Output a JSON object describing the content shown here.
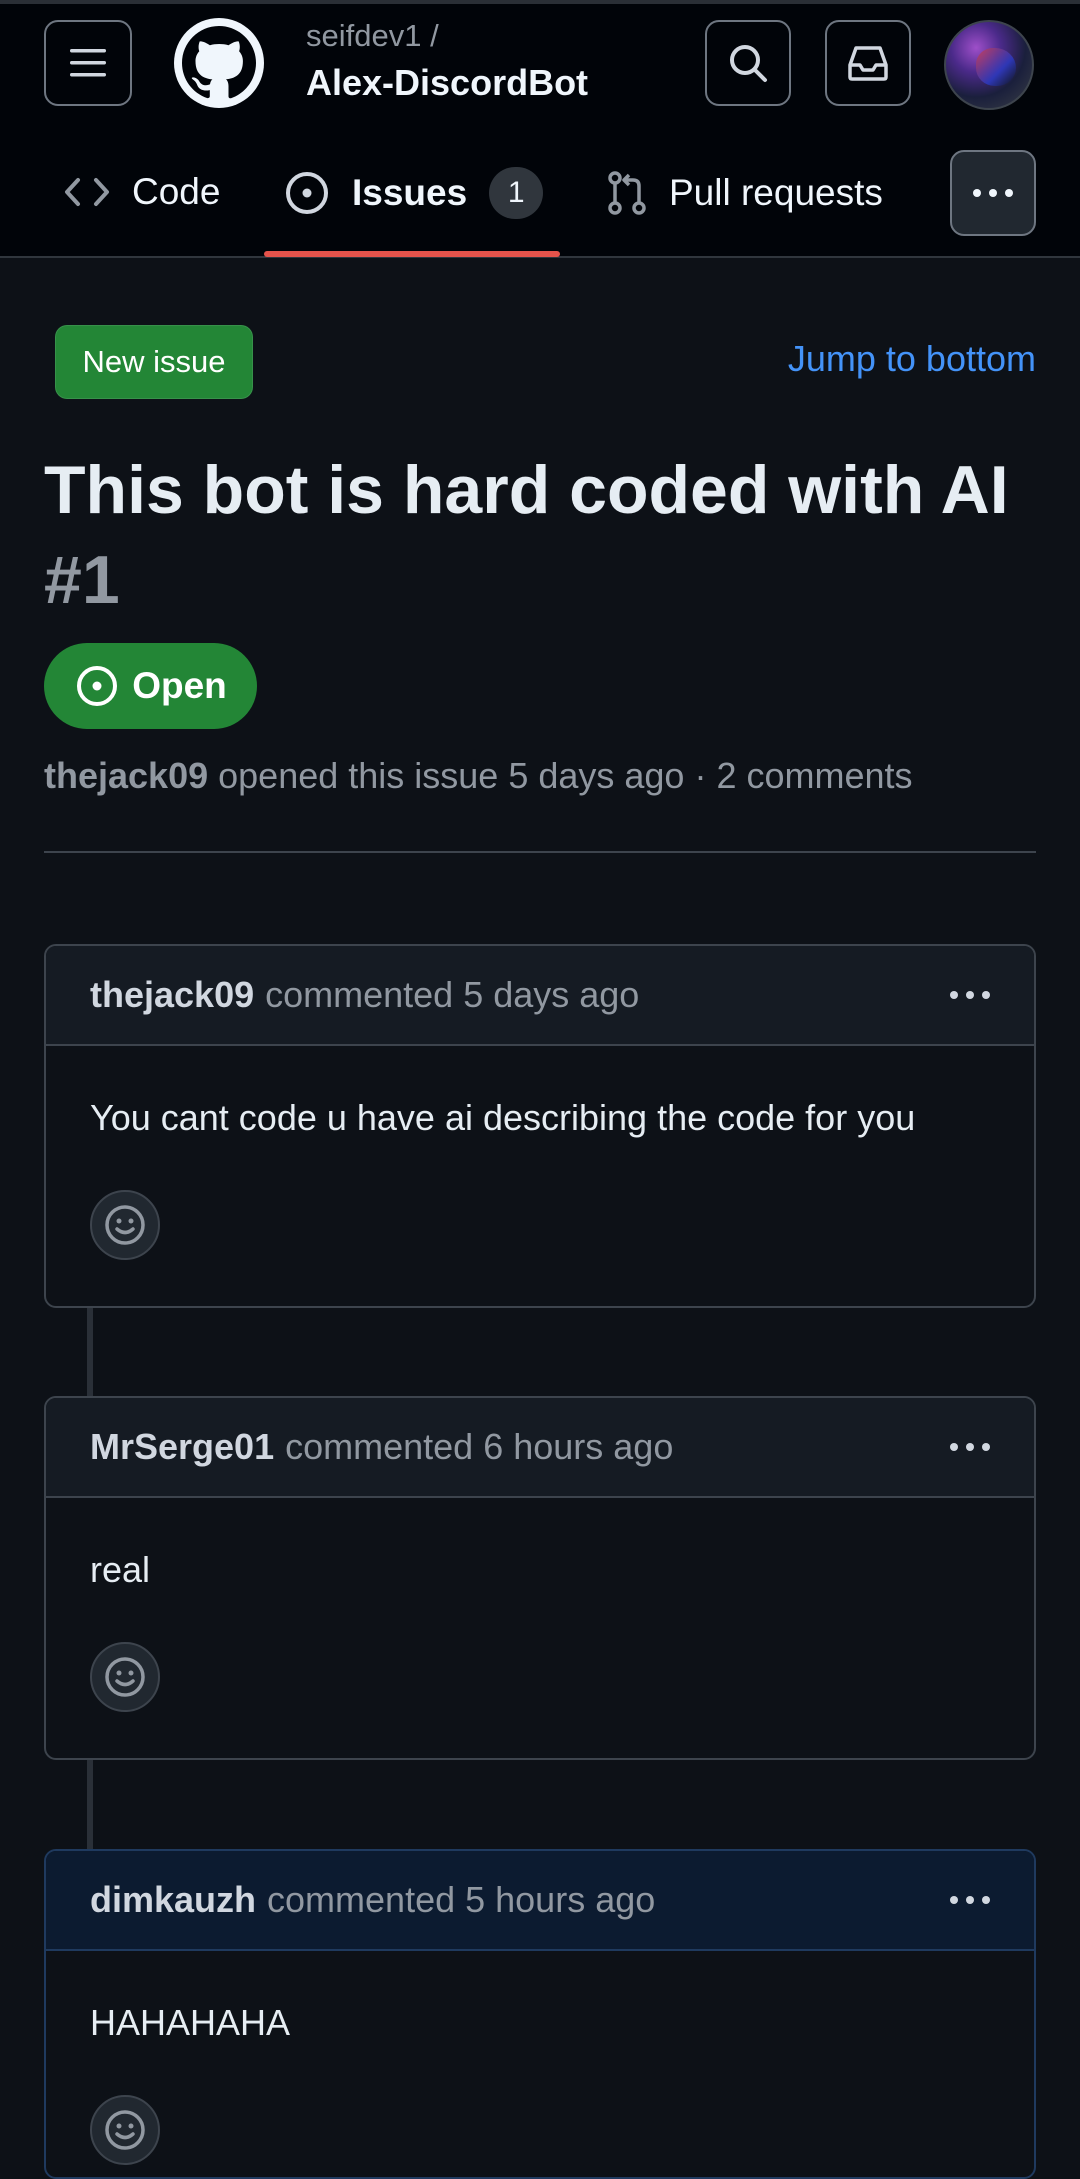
{
  "header": {
    "owner": "seifdev1 /",
    "repo": "Alex-DiscordBot"
  },
  "tabs": [
    {
      "label": "Code"
    },
    {
      "label": "Issues",
      "count": "1"
    },
    {
      "label": "Pull requests"
    }
  ],
  "actions": {
    "new_issue": "New issue",
    "jump_to_bottom": "Jump to bottom"
  },
  "issue": {
    "title": "This bot is hard coded with AI",
    "number": "#1",
    "state": "Open",
    "author": "thejack09",
    "meta_text": "opened this issue 5 days ago · 2 comments"
  },
  "comments": [
    {
      "author": "thejack09",
      "when": "commented 5 days ago",
      "body": "You cant code u have ai describing the code for you"
    },
    {
      "author": "MrSerge01",
      "when": "commented 6 hours ago",
      "body": "real"
    },
    {
      "author": "dimkauzh",
      "when": "commented 5 hours ago",
      "body": "HAHAHAHA"
    }
  ],
  "colors": {
    "background": "#0d1117",
    "accent_green": "#238636",
    "link_blue": "#4493f8",
    "tab_underline": "#e5534b"
  }
}
